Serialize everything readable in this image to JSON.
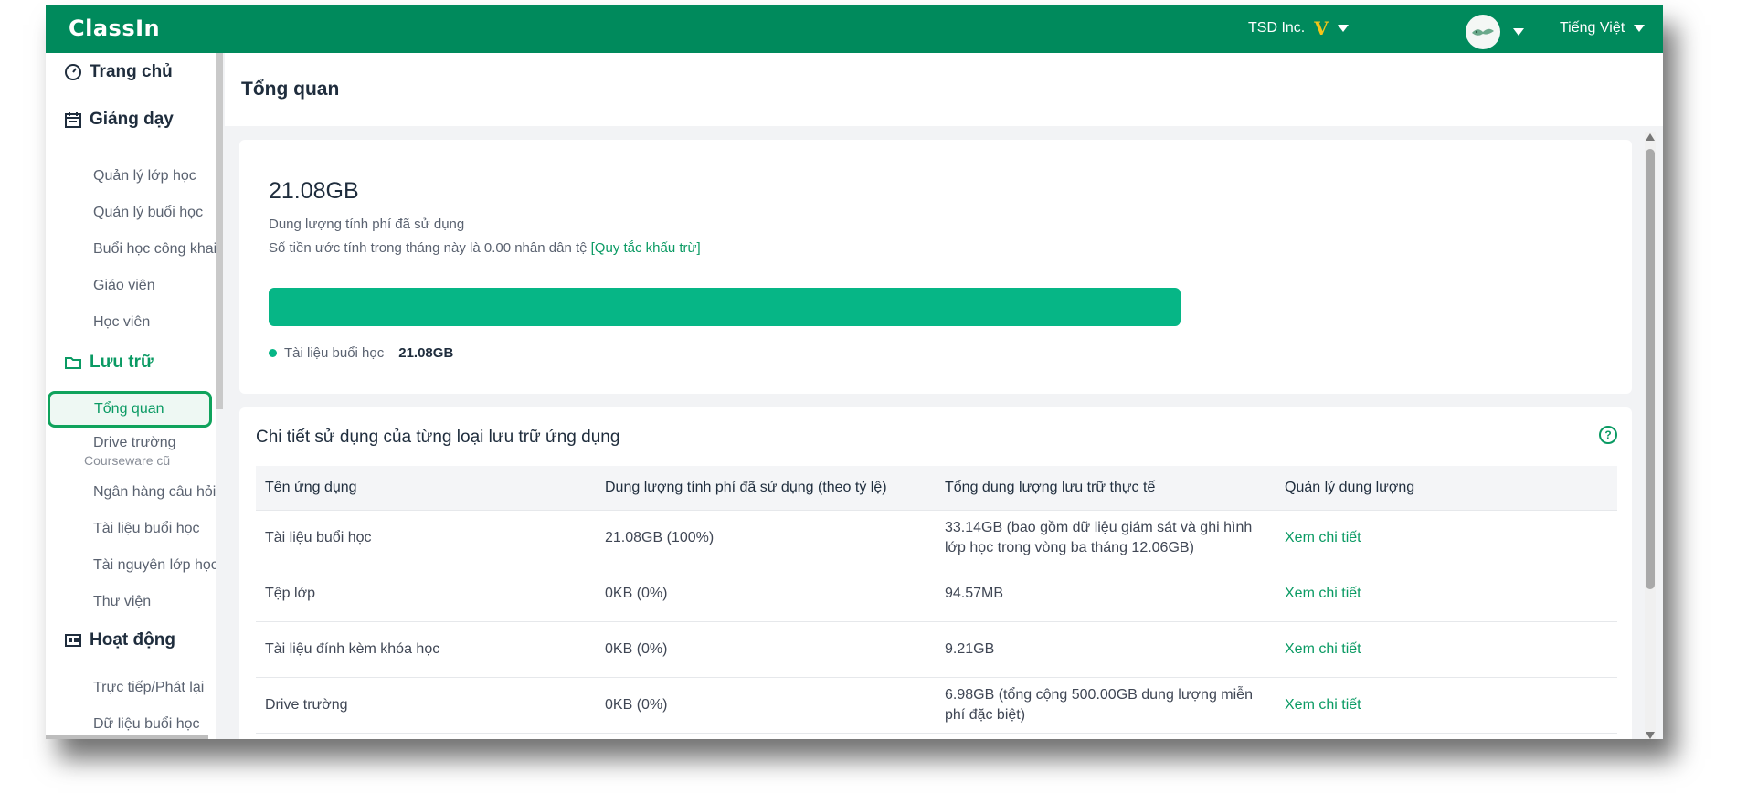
{
  "topbar": {
    "brand": "ClassIn",
    "org_name": "TSD Inc.",
    "org_badge": "V",
    "language": "Tiếng Việt"
  },
  "sidebar": {
    "home": "Trang chủ",
    "teaching": {
      "label": "Giảng dạy",
      "items": [
        "Quản lý lớp học",
        "Quản lý buổi học",
        "Buổi học công khai",
        "Giáo viên",
        "Học viên"
      ]
    },
    "storage": {
      "label": "Lưu trữ",
      "items": [
        "Tổng quan",
        "Drive trường",
        "Courseware cũ",
        "Ngân hàng câu hỏi",
        "Tài liệu buổi học",
        "Tài nguyên lớp học",
        "Thư viện"
      ]
    },
    "activity": {
      "label": "Hoạt động",
      "items": [
        "Trực tiếp/Phát lại",
        "Dữ liệu buổi học"
      ]
    }
  },
  "page": {
    "title": "Tổng quan"
  },
  "usage": {
    "total": "21.08GB",
    "label": "Dung lượng tính phí đã sử dụng",
    "estimate_text": "Số tiền ước tính trong tháng này là 0.00 nhân dân tệ",
    "rules_link": "[Quy tắc khấu trừ]",
    "bar_fraction": 1.0,
    "legend_label": "Tài liệu buổi học",
    "legend_value": "21.08GB",
    "bar_color": "#06b686"
  },
  "details": {
    "title": "Chi tiết sử dụng của từng loại lưu trữ ứng dụng",
    "headers": [
      "Tên ứng dụng",
      "Dung lượng tính phí đã sử dụng (theo tỷ lệ)",
      "Tổng dung lượng lưu trữ thực tế",
      "Quản lý dung lượng"
    ],
    "rows": [
      [
        "Tài liệu buổi học",
        "21.08GB  (100%)",
        "33.14GB (bao gồm dữ liệu giám sát và ghi hình lớp học trong vòng ba tháng 12.06GB)",
        "Xem chi tiết"
      ],
      [
        "Tệp lớp",
        "0KB  (0%)",
        "94.57MB",
        "Xem chi tiết"
      ],
      [
        "Tài liệu đính kèm khóa học",
        "0KB  (0%)",
        "9.21GB",
        "Xem chi tiết"
      ],
      [
        "Drive trường",
        "0KB  (0%)",
        "6.98GB (tổng cộng 500.00GB dung lượng miễn phí đặc biệt)",
        "Xem chi tiết"
      ]
    ]
  }
}
